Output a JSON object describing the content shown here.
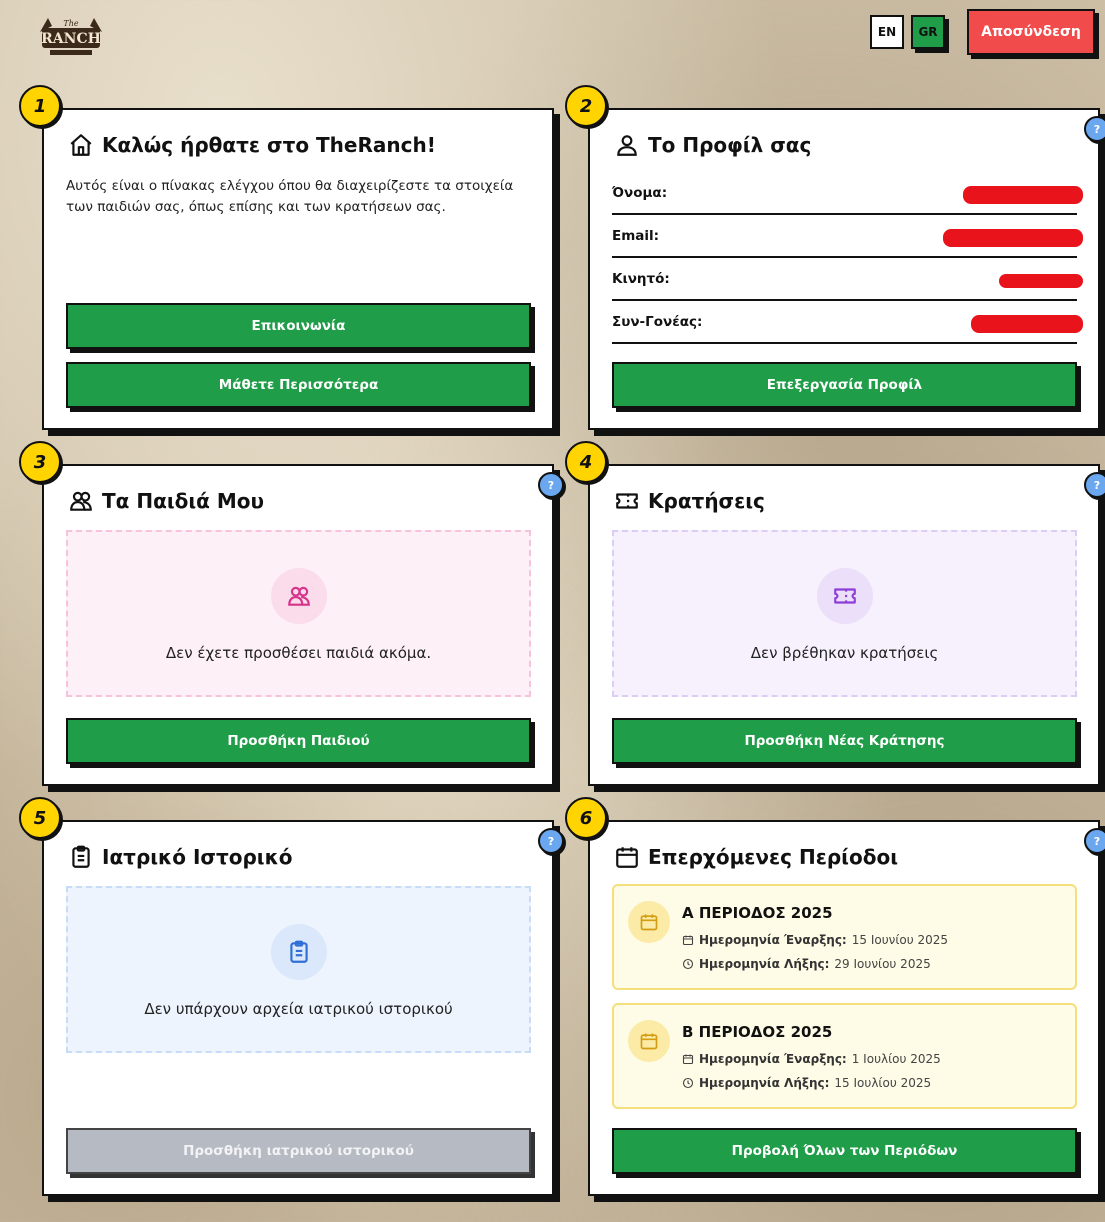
{
  "header": {
    "logo_text": "The RANCH",
    "lang_en": "EN",
    "lang_gr": "GR",
    "logout": "Αποσύνδεση"
  },
  "cards": {
    "welcome": {
      "number": "1",
      "title": "Καλώς ήρθατε στο TheRanch!",
      "text": "Αυτός είναι ο πίνακας ελέγχου όπου θα διαχειρίζεστε τα στοιχεία των παιδιών σας, όπως επίσης και των κρατήσεων σας.",
      "contact_button": "Επικοινωνία",
      "learn_button": "Μάθετε Περισσότερα"
    },
    "profile": {
      "number": "2",
      "title": "Το Προφίλ σας",
      "help": "?",
      "fields": [
        {
          "label": "Όνομα:"
        },
        {
          "label": "Email:"
        },
        {
          "label": "Κινητό:"
        },
        {
          "label": "Συν-Γονέας:"
        }
      ],
      "edit_button": "Επεξεργασία Προφίλ"
    },
    "children": {
      "number": "3",
      "title": "Τα Παιδιά Μου",
      "help": "?",
      "empty_text": "Δεν έχετε προσθέσει παιδιά ακόμα.",
      "add_button": "Προσθήκη Παιδιού"
    },
    "bookings": {
      "number": "4",
      "title": "Κρατήσεις",
      "help": "?",
      "empty_text": "Δεν βρέθηκαν κρατήσεις",
      "add_button": "Προσθήκη Νέας Κράτησης"
    },
    "medical": {
      "number": "5",
      "title": "Ιατρικό Ιστορικό",
      "help": "?",
      "empty_text": "Δεν υπάρχουν αρχεία ιατρικού ιστορικού",
      "add_button": "Προσθήκη ιατρικού ιστορικού"
    },
    "periods": {
      "number": "6",
      "title": "Επερχόμενες Περίοδοι",
      "help": "?",
      "start_label": "Ημερομηνία Έναρξης:",
      "end_label": "Ημερομηνία Λήξης:",
      "items": [
        {
          "name": "Α ΠΕΡΙΟΔΟΣ 2025",
          "start": "15 Ιουνίου 2025",
          "end": "29 Ιουνίου 2025"
        },
        {
          "name": "Β ΠΕΡΙΟΔΟΣ 2025",
          "start": "1 Ιουλίου 2025",
          "end": "15 Ιουλίου 2025"
        }
      ],
      "view_all_button": "Προβολή Όλων των Περιόδων"
    }
  },
  "colors": {
    "primary_green": "#1f9d48",
    "logout_red": "#f24b4b",
    "badge_yellow": "#ffd400",
    "help_blue": "#6aa7ee"
  }
}
